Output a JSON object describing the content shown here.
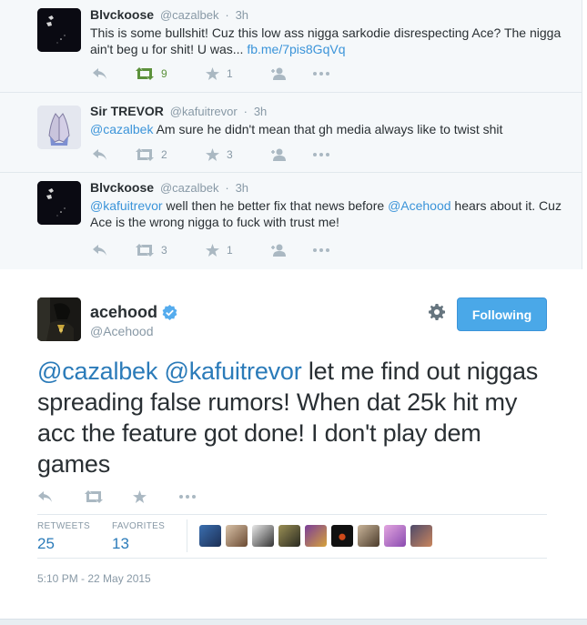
{
  "replies": [
    {
      "name": "Blvckoose",
      "handle": "@cazalbek",
      "time": "3h",
      "text_before": "This is some bullshit! Cuz this low ass nigga sarkodie disrespecting Ace? The nigga ain't beg u for shit! U was... ",
      "link": "fb.me/7pis8GqVq",
      "retweets": "9",
      "favorites": "1"
    },
    {
      "name": "Sir TREVOR",
      "handle": "@kafuitrevor",
      "time": "3h",
      "mention": "@cazalbek",
      "text": " Am sure he didn't mean that gh media always like to twist shit",
      "retweets": "2",
      "favorites": "3"
    },
    {
      "name": "Blvckoose",
      "handle": "@cazalbek",
      "time": "3h",
      "mention": "@kafuitrevor",
      "text_mid": " well then he better fix that news before ",
      "mention2": "@Acehood",
      "text_end": " hears about it. Cuz Ace is the wrong nigga to fuck with trust me!",
      "retweets": "3",
      "favorites": "1"
    }
  ],
  "main": {
    "name": "acehood",
    "handle": "@Acehood",
    "follow_label": "Following",
    "mention1": "@cazalbek",
    "mention2": "@kafuitrevor",
    "text": "  let me find out niggas spreading false rumors! When dat 25k hit my acc the feature got done! I don't play dem games",
    "retweets_label": "RETWEETS",
    "retweets": "25",
    "favorites_label": "FAVORITES",
    "favorites": "13",
    "timestamp": "5:10 PM - 22 May 2015"
  },
  "colors": {
    "link": "#3b94d9",
    "follow_button": "#4aa8e8",
    "retweet_active": "#5c913b",
    "muted": "#8899a6"
  }
}
